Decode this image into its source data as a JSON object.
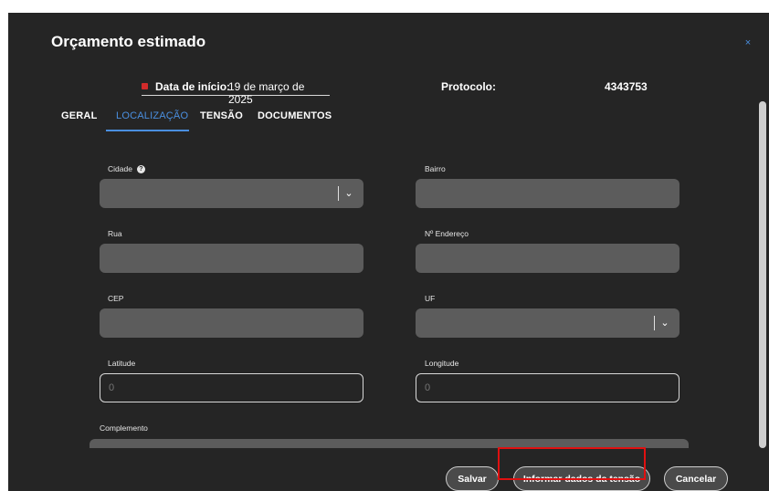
{
  "modal": {
    "title": "Orçamento estimado",
    "close_icon": "×"
  },
  "header": {
    "start_date_label": "Data de início:",
    "start_date_value": "19 de março de 2025",
    "protocol_label": "Protocolo:",
    "protocol_value": "4343753"
  },
  "tabs": [
    {
      "label": "GERAL",
      "active": false
    },
    {
      "label": "LOCALIZAÇÃO",
      "active": true
    },
    {
      "label": "TENSÃO",
      "active": false
    },
    {
      "label": "DOCUMENTOS",
      "active": false
    }
  ],
  "fields": {
    "cidade": {
      "label": "Cidade",
      "value": ""
    },
    "bairro": {
      "label": "Bairro",
      "value": ""
    },
    "rua": {
      "label": "Rua",
      "value": ""
    },
    "numero": {
      "label": "Nº Endereço",
      "value": ""
    },
    "cep": {
      "label": "CEP",
      "value": ""
    },
    "uf": {
      "label": "UF",
      "value": ""
    },
    "latitude": {
      "label": "Latitude",
      "placeholder": "0"
    },
    "longitude": {
      "label": "Longitude",
      "placeholder": "0"
    },
    "complemento": {
      "label": "Complemento",
      "value": ""
    }
  },
  "icons": {
    "help": "?",
    "chevron": "⌄"
  },
  "footer": {
    "save_label": "Salvar",
    "inform_label": "Informar dados da tensão",
    "cancel_label": "Cancelar"
  },
  "colors": {
    "modal_bg": "#252525",
    "accent": "#4a8fe0",
    "field_bg": "#5c5c5c",
    "highlight": "#e01010",
    "required_marker": "#d22b2b"
  }
}
